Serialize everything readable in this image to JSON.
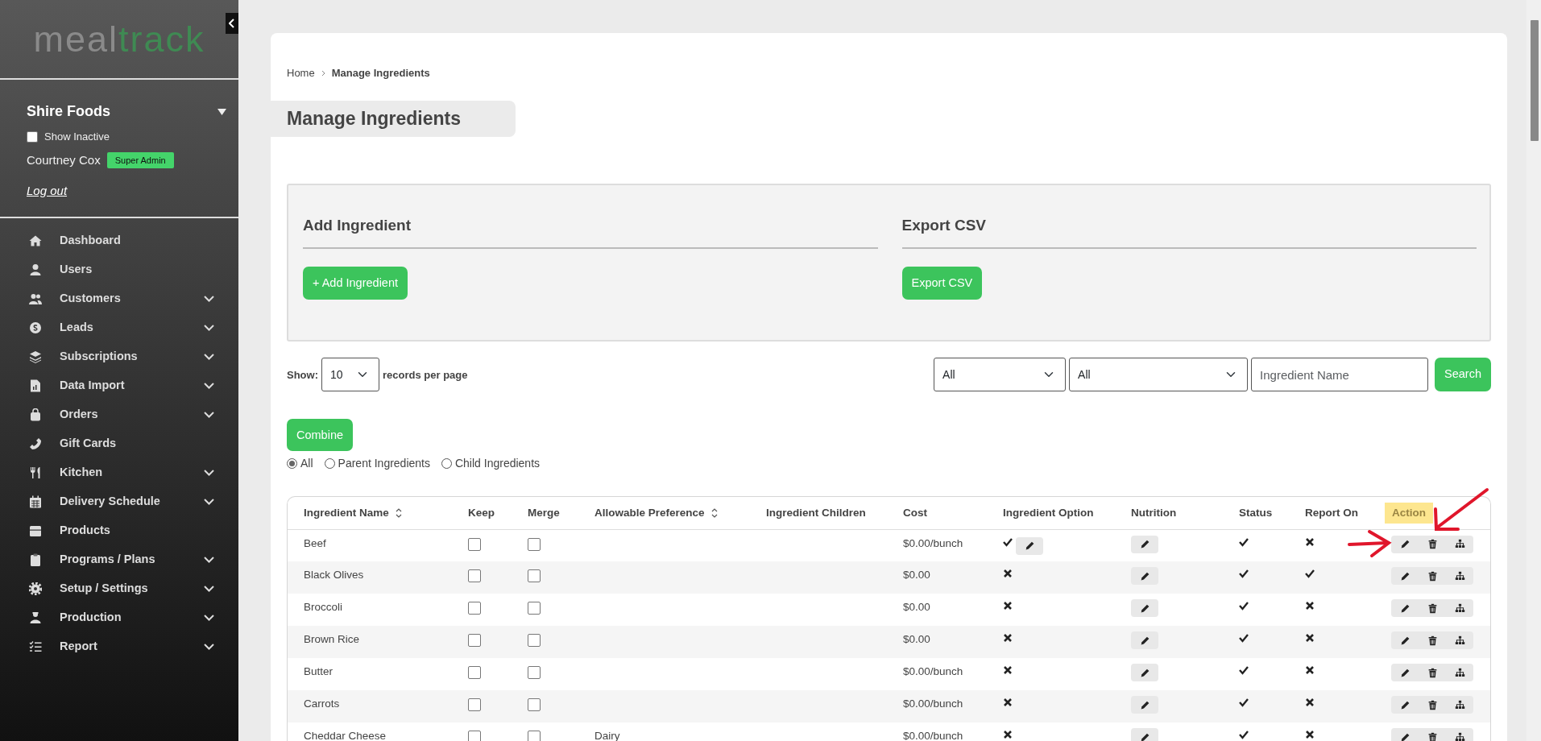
{
  "sidebar": {
    "logo": [
      "meal",
      "track"
    ],
    "company": "Shire Foods",
    "show_inactive": {
      "label": "Show Inactive",
      "checked": false
    },
    "user": {
      "name": "Courtney Cox",
      "role": "Super Admin"
    },
    "logout": "Log out",
    "items": [
      {
        "label": "Dashboard",
        "has_submenu": false
      },
      {
        "label": "Users",
        "has_submenu": false
      },
      {
        "label": "Customers",
        "has_submenu": true
      },
      {
        "label": "Leads",
        "has_submenu": true
      },
      {
        "label": "Subscriptions",
        "has_submenu": true
      },
      {
        "label": "Data Import",
        "has_submenu": true
      },
      {
        "label": "Orders",
        "has_submenu": true
      },
      {
        "label": "Gift Cards",
        "has_submenu": false
      },
      {
        "label": "Kitchen",
        "has_submenu": true
      },
      {
        "label": "Delivery Schedule",
        "has_submenu": true
      },
      {
        "label": "Products",
        "has_submenu": false
      },
      {
        "label": "Programs / Plans",
        "has_submenu": true
      },
      {
        "label": "Setup / Settings",
        "has_submenu": true
      },
      {
        "label": "Production",
        "has_submenu": true
      },
      {
        "label": "Report",
        "has_submenu": true
      }
    ]
  },
  "breadcrumb": [
    "Home",
    "Manage Ingredients"
  ],
  "page_title": "Manage Ingredients",
  "panels": [
    {
      "heading": "Add Ingredient",
      "button": "+ Add Ingredient"
    },
    {
      "heading": "Export CSV",
      "button": "Export CSV"
    }
  ],
  "show": {
    "label": "Show:",
    "value": "10",
    "suffix": "records per page"
  },
  "filters": {
    "select_1": "All",
    "select_2": "All",
    "search_placeholder": "Ingredient Name",
    "search_button": "Search"
  },
  "combine_button": "Combine",
  "radios": [
    {
      "label": "All",
      "selected": true
    },
    {
      "label": "Parent Ingredients",
      "selected": false
    },
    {
      "label": "Child Ingredients",
      "selected": false
    }
  ],
  "table": {
    "columns": [
      {
        "label": "Ingredient Name",
        "sortable": true,
        "highlighted": false
      },
      {
        "label": "Keep",
        "sortable": false,
        "highlighted": false
      },
      {
        "label": "Merge",
        "sortable": false,
        "highlighted": false
      },
      {
        "label": "Allowable Preference",
        "sortable": true,
        "highlighted": false
      },
      {
        "label": "Ingredient Children",
        "sortable": false,
        "highlighted": false
      },
      {
        "label": "Cost",
        "sortable": false,
        "highlighted": false
      },
      {
        "label": "Ingredient Option",
        "sortable": false,
        "highlighted": false
      },
      {
        "label": "Nutrition",
        "sortable": false,
        "highlighted": false
      },
      {
        "label": "Status",
        "sortable": false,
        "highlighted": false
      },
      {
        "label": "Report On",
        "sortable": false,
        "highlighted": false
      },
      {
        "label": "Action",
        "sortable": false,
        "highlighted": true
      }
    ],
    "rows": [
      {
        "name": "Beef",
        "keep": false,
        "merge": false,
        "cost": "$0.00/bunch",
        "option": true,
        "option_editable": true,
        "status": true,
        "report_on": false
      },
      {
        "name": "Black Olives",
        "keep": false,
        "merge": false,
        "cost": "$0.00",
        "option": false,
        "option_editable": false,
        "status": true,
        "report_on": true
      },
      {
        "name": "Broccoli",
        "keep": false,
        "merge": false,
        "cost": "$0.00",
        "option": false,
        "option_editable": false,
        "status": true,
        "report_on": false
      },
      {
        "name": "Brown Rice",
        "keep": false,
        "merge": false,
        "cost": "$0.00",
        "option": false,
        "option_editable": false,
        "status": true,
        "report_on": false
      },
      {
        "name": "Butter",
        "keep": false,
        "merge": false,
        "cost": "$0.00/bunch",
        "option": false,
        "option_editable": false,
        "status": true,
        "report_on": false
      },
      {
        "name": "Carrots",
        "keep": false,
        "merge": false,
        "cost": "$0.00/bunch",
        "option": false,
        "option_editable": false,
        "status": true,
        "report_on": false
      },
      {
        "name": "Cheddar Cheese",
        "keep": false,
        "merge": false,
        "allowable_preference": "Dairy",
        "cost": "$0.00/bunch",
        "option": false,
        "option_editable": false,
        "status": true,
        "report_on": false
      }
    ]
  },
  "annotations": [
    {
      "kind": "horizontal_arrow"
    },
    {
      "kind": "diagonal_arrow"
    }
  ]
}
